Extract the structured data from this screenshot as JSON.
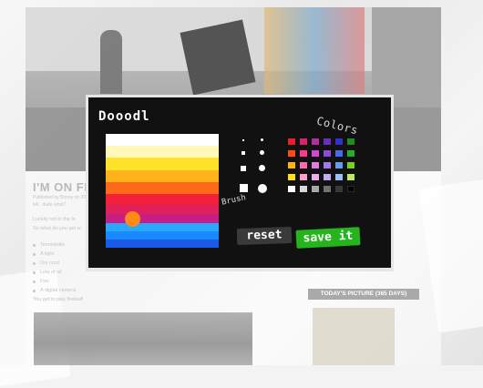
{
  "blog": {
    "post_title": "I'M ON FI",
    "meta_line1": "Published by Bonny on 20",
    "meta_line2": "tell.. dude what?",
    "para1": "Luckily not in the lo",
    "para2": "So what do you get w",
    "bullets": [
      "Tennisballs",
      "A light",
      "Dry cord",
      "Lots of oil",
      "Fire",
      "A digital camera"
    ],
    "closing": "You get to play fireball!",
    "sidebar_widget_title": "TODAY'S PICTURE (365 DAYS)"
  },
  "doodle": {
    "logo": "Dooodl",
    "colors_label": "Colors",
    "brush_label": "Brush",
    "reset_label": "reset",
    "save_label": "save it",
    "palette": [
      "#e8202a",
      "#e0206e",
      "#b02fa0",
      "#6a2fc0",
      "#3232c8",
      "#1e8c1e",
      "#ff4a14",
      "#ff3a8a",
      "#d04ad0",
      "#8a4ae0",
      "#4a6ae8",
      "#22b02a",
      "#ffb01a",
      "#ff6aa8",
      "#e27ae2",
      "#a27ae8",
      "#6a9af0",
      "#7ad01a",
      "#ffe21a",
      "#ffa0c8",
      "#f0aaf0",
      "#c0aaf0",
      "#9ac0f6",
      "#c0e85a",
      "#ffffff",
      "#d8d8d8",
      "#a8a8a8",
      "#707070",
      "#383838",
      "#000000"
    ],
    "canvas_colors": [
      "#fff8b8",
      "#ffe22a",
      "#ffb21a",
      "#ff6a1a",
      "#f2203a",
      "#e0205a",
      "#c61e84",
      "#2aa8ff",
      "#1a88ff",
      "#1a5ae8"
    ]
  }
}
